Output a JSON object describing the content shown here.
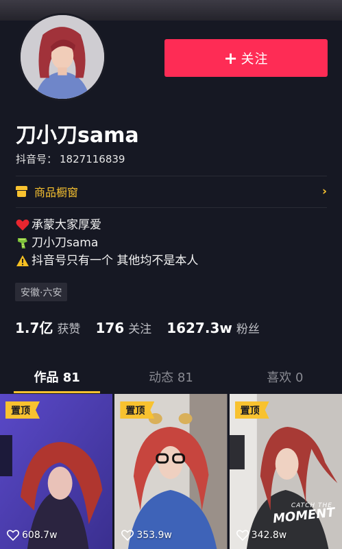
{
  "profile": {
    "nickname": "刀小刀sama",
    "douyin_id_label": "抖音号：",
    "douyin_id": "1827116839",
    "follow_label": "关注",
    "follow_plus": "+"
  },
  "shop": {
    "label": "商品橱窗",
    "chevron": "›",
    "icon": "shop-icon"
  },
  "bio": [
    {
      "icon": "heart-icon",
      "text": "承蒙大家厚爱"
    },
    {
      "icon": "scarf-icon",
      "text": "刀小刀sama"
    },
    {
      "icon": "warning-icon",
      "text": "抖音号只有一个 其他均不是本人"
    }
  ],
  "location": "安徽·六安",
  "stats": [
    {
      "value": "1.7亿",
      "label": "获赞"
    },
    {
      "value": "176",
      "label": "关注"
    },
    {
      "value": "1627.3w",
      "label": "粉丝"
    }
  ],
  "tabs": [
    {
      "label": "作品 81",
      "active": true
    },
    {
      "label": "动态 81",
      "active": false
    },
    {
      "label": "喜欢 0",
      "active": false
    }
  ],
  "videos": [
    {
      "pinned_label": "置顶",
      "likes": "608.7w"
    },
    {
      "pinned_label": "置顶",
      "likes": "353.9w"
    },
    {
      "pinned_label": "置顶",
      "likes": "342.8w",
      "overlay_text_1": "CATCH THE",
      "overlay_text_2": "MOMENT"
    }
  ],
  "colors": {
    "accent": "#fe2c55",
    "yellow": "#f8c230",
    "bg": "#161823"
  }
}
